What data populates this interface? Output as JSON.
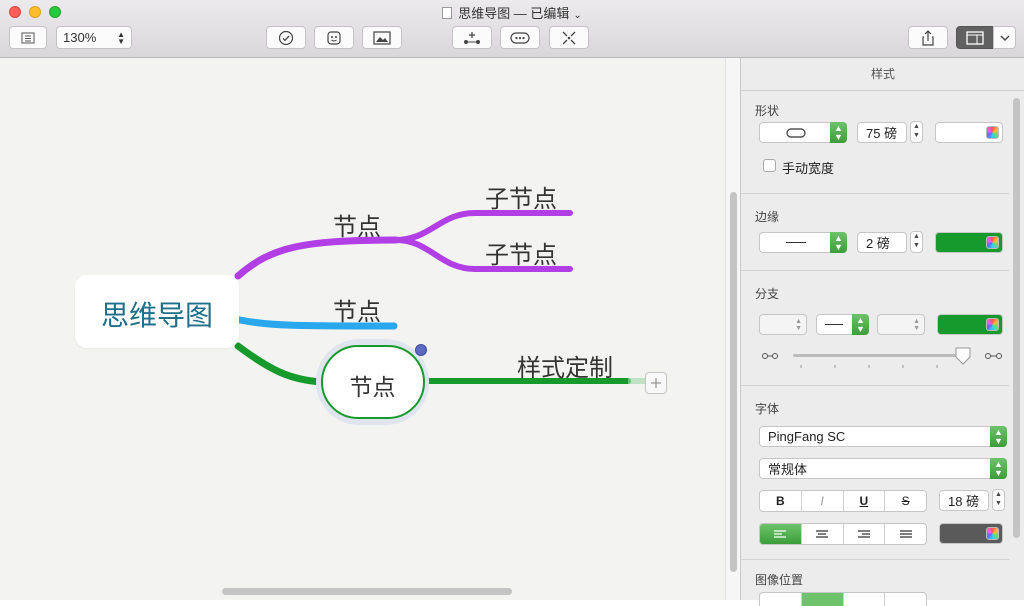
{
  "window": {
    "title": "思维导图 — 已编辑"
  },
  "toolbar": {
    "zoom": "130%"
  },
  "mindmap": {
    "root": "思维导图",
    "branches": [
      {
        "label": "节点",
        "children": [
          "子节点",
          "子节点"
        ]
      },
      {
        "label": "节点"
      },
      {
        "label": "节点",
        "children": [
          "样式定制"
        ]
      }
    ],
    "colors": {
      "purple": "#b23ee6",
      "blue": "#2aa8ee",
      "green": "#169a2c",
      "root_text": "#1f6f8b"
    }
  },
  "inspector": {
    "title": "样式",
    "shape": {
      "heading": "形状",
      "size": "75 磅",
      "manual_width": "手动宽度"
    },
    "border": {
      "heading": "边缘",
      "width": "2 磅",
      "color": "#169a2c"
    },
    "branch": {
      "heading": "分支",
      "color": "#169a2c"
    },
    "font": {
      "heading": "字体",
      "family": "PingFang SC",
      "style": "常规体",
      "size": "18 磅",
      "bold": "B",
      "italic": "I",
      "underline": "U",
      "strike": "S",
      "color": "#5a5a5a"
    },
    "image_position": {
      "heading": "图像位置"
    }
  }
}
